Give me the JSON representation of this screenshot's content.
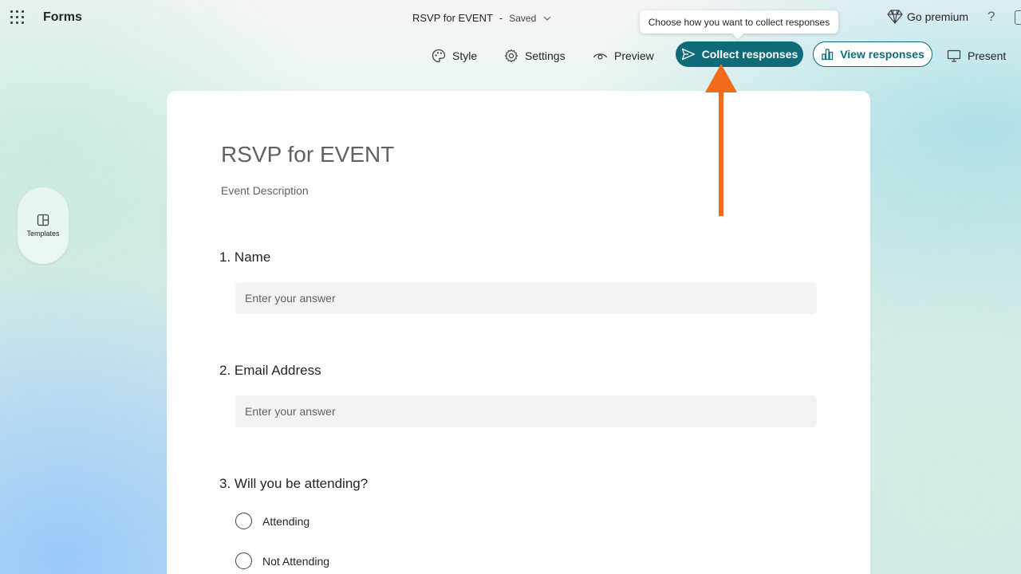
{
  "app": {
    "name": "Forms"
  },
  "document": {
    "title": "RSVP for EVENT",
    "separator": "-",
    "status": "Saved"
  },
  "tooltip": {
    "text": "Choose how you want to collect responses"
  },
  "header": {
    "go_premium": "Go premium",
    "help": "?"
  },
  "toolbar": {
    "style": "Style",
    "settings": "Settings",
    "preview": "Preview",
    "collect": "Collect responses",
    "view": "View responses",
    "present": "Present"
  },
  "sidebar": {
    "templates": "Templates"
  },
  "colors": {
    "accent": "#0f6b77",
    "annotation_arrow": "#f26a1b"
  },
  "form": {
    "title": "RSVP for EVENT",
    "description": "Event Description",
    "questions": [
      {
        "number": "1.",
        "title": "Name",
        "placeholder": "Enter your answer"
      },
      {
        "number": "2.",
        "title": "Email Address",
        "placeholder": "Enter your answer"
      },
      {
        "number": "3.",
        "title": "Will you be attending?",
        "options": [
          "Attending",
          "Not Attending"
        ]
      }
    ]
  }
}
